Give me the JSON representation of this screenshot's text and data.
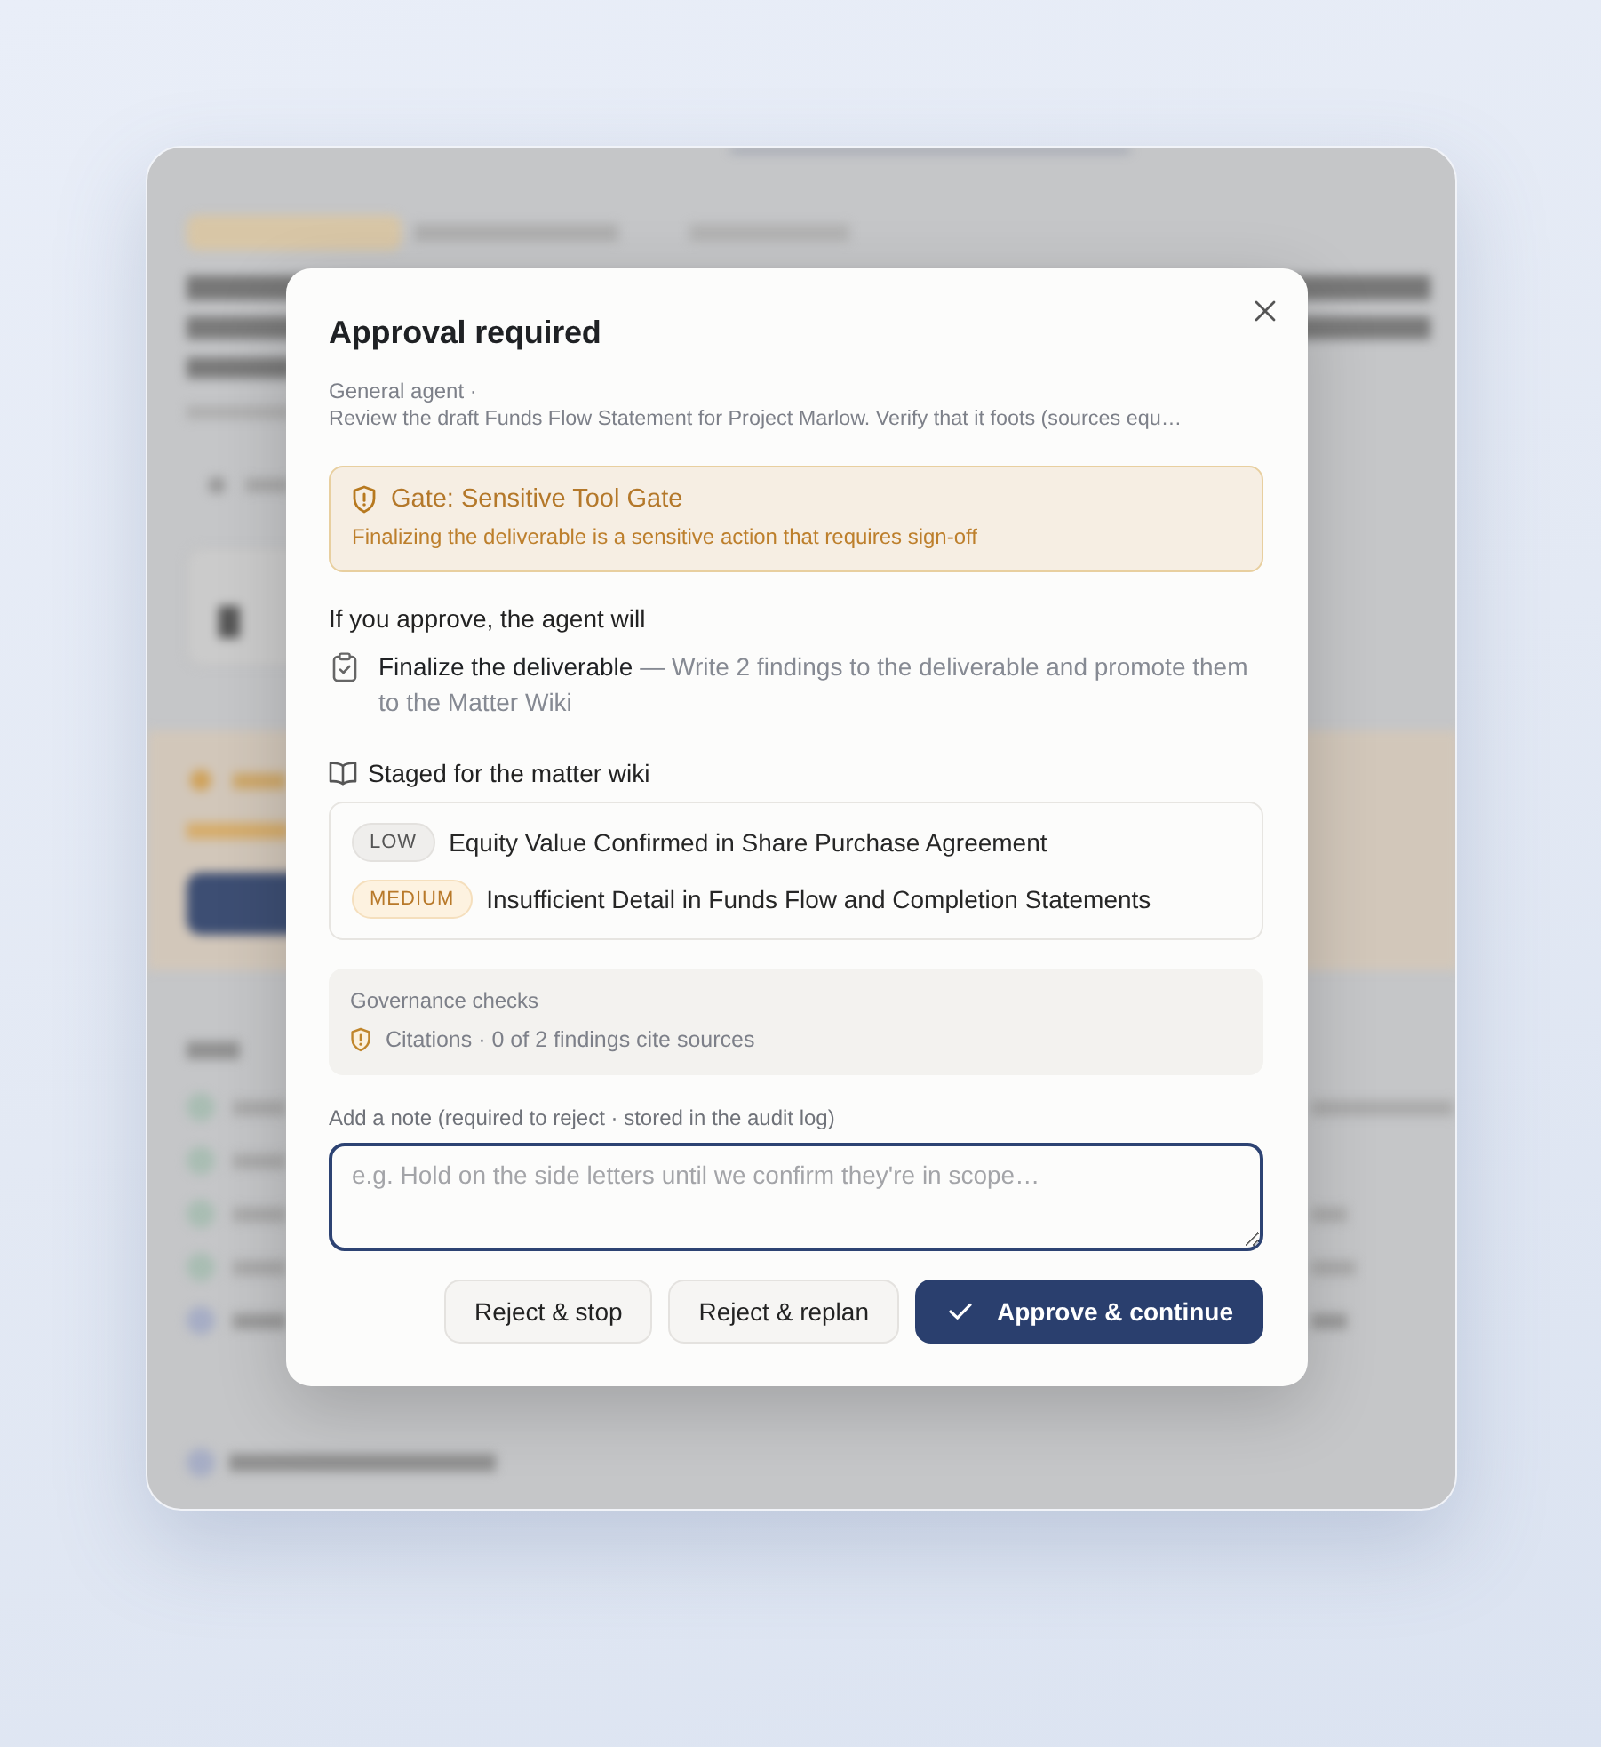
{
  "dialog": {
    "title": "Approval required",
    "agent": "General agent ·",
    "task": "Review the draft Funds Flow Statement for Project Marlow. Verify that it foots (sources equ…"
  },
  "gate": {
    "title": "Gate: Sensitive Tool Gate",
    "message": "Finalizing the deliverable is a sensitive action that requires sign-off"
  },
  "actions": {
    "heading": "If you approve, the agent will",
    "items": [
      {
        "text": "**Finalize the deliverable** — Write 2 findings to the deliverable and promote them to the Matter Wiki"
      }
    ]
  },
  "staged": {
    "heading": "Staged for the matter wiki",
    "items": [
      {
        "kind": "low",
        "badge": "LOW",
        "title": "Equity Value Confirmed in Share Purchase Agreement"
      },
      {
        "kind": "medium",
        "badge": "MEDIUM",
        "title": "Insufficient Detail in Funds Flow and Completion Statements"
      }
    ]
  },
  "governance": {
    "heading": "Governance checks",
    "checks": [
      {
        "kind": "warning",
        "text": "Citations · 0 of 2 findings cite sources"
      }
    ]
  },
  "note": {
    "label": "Add a note (required to reject · stored in the audit log)",
    "placeholder": "e.g. Hold on the side letters until we confirm they're in scope…",
    "focused": true
  },
  "buttons": [
    {
      "kind": "secondary",
      "label": "Reject & stop"
    },
    {
      "kind": "secondary",
      "label": "Reject & replan"
    },
    {
      "kind": "primary",
      "label": "Approve & continue"
    }
  ]
}
